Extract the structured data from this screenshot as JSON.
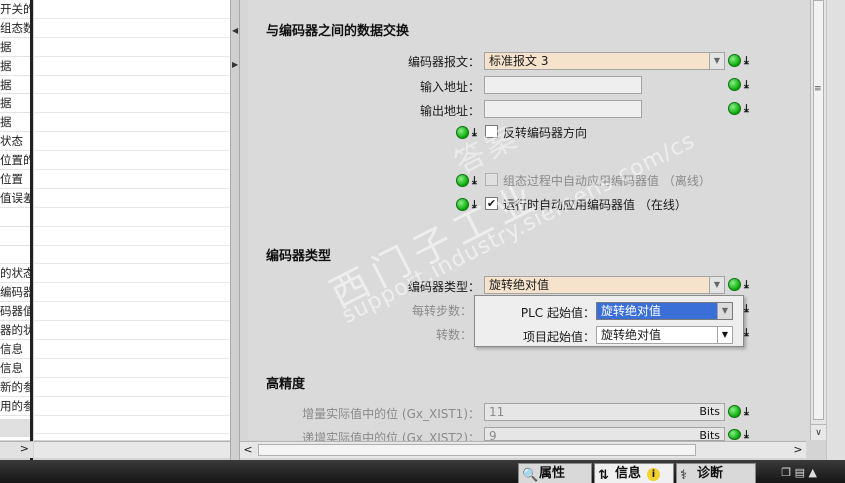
{
  "left_list": {
    "rows": [
      "开关的",
      "组态数",
      "据",
      "据",
      "据",
      "据",
      "据",
      "状态",
      "位置的",
      "位置",
      "值误差",
      "",
      "",
      "",
      "的状态",
      "编码器",
      "码器值",
      "器的状",
      "信息",
      "信息",
      "新的参",
      "用的参",
      ""
    ]
  },
  "sections": {
    "data_exchange_title": "与编码器之间的数据交换",
    "encoder_type_title": "编码器类型",
    "high_precision_title": "高精度"
  },
  "fields": {
    "telegram_label": "编码器报文：",
    "telegram_value": "标准报文 3",
    "input_addr_label": "输入地址：",
    "input_addr_value": "",
    "output_addr_label": "输出地址：",
    "output_addr_value": "",
    "invert_dir_label": "反转编码器方向",
    "auto_apply_offline_label": "组态过程中自动应用编码器值 （离线）",
    "auto_apply_online_label": "运行时自动应用编码器值 （在线）",
    "encoder_type_label": "编码器类型：",
    "encoder_type_value": "旋转绝对值",
    "steps_per_rev_label": "每转步数：",
    "revolutions_label": "转数：",
    "incr_bits_label": "增量实际值中的位 (Gx_XIST1)：",
    "incr_bits_value": "11",
    "abs_bits_label": "递增实际值中的位 (Gx_XIST2)：",
    "abs_bits_value": "9",
    "bits_unit": "Bits"
  },
  "popup": {
    "plc_start_label": "PLC 起始值：",
    "plc_start_value": "旋转绝对值",
    "project_start_label": "项目起始值：",
    "project_start_value": "旋转绝对值"
  },
  "tabs": {
    "properties": "属性",
    "info": "信息",
    "diagnostics": "诊断"
  },
  "watermark": {
    "line1": "西门子工业",
    "line2": "support.industry.siemens.com/cs",
    "line3": "答案"
  },
  "icons": {
    "status_dot": "green-status-dot",
    "download": "download-icon",
    "dropdown": "chevron-down-icon"
  },
  "colors": {
    "peach_field": "#f5e3cc",
    "selection_blue": "#3a6fd8",
    "status_green": "#17b317"
  }
}
